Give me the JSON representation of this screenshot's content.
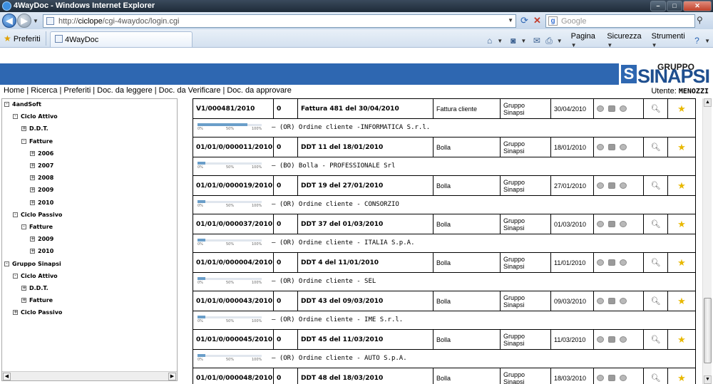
{
  "window": {
    "title": "4WayDoc - Windows Internet Explorer",
    "min": "–",
    "max": "□",
    "close": "✕"
  },
  "address": {
    "url_prefix": "http://",
    "url_host": "ciclope",
    "url_path": "/cgi-4waydoc/login.cgi",
    "search_placeholder": "Google"
  },
  "commandbar": {
    "favorites_label": "Preferiti",
    "tab_label": "4WayDoc",
    "menus": [
      "Pagina",
      "Sicurezza",
      "Strumenti"
    ]
  },
  "brand": {
    "gruppo": "GRUPPO",
    "name": "SINAPSI",
    "mark": "S"
  },
  "nav": {
    "items": [
      "Home",
      "Ricerca",
      "Preferiti",
      "Doc. da leggere",
      "Doc. da Verificare",
      "Doc. da approvare"
    ],
    "user_label": "Utente:",
    "user_name": "MENOZZI"
  },
  "tree": [
    {
      "label": "4andSoft",
      "sign": "-",
      "level": 0
    },
    {
      "label": "Ciclo Attivo",
      "sign": "-",
      "level": 1
    },
    {
      "label": "D.D.T.",
      "sign": "+",
      "level": 2
    },
    {
      "label": "Fatture",
      "sign": "-",
      "level": 2
    },
    {
      "label": "2006",
      "sign": "+",
      "level": 3
    },
    {
      "label": "2007",
      "sign": "+",
      "level": 3
    },
    {
      "label": "2008",
      "sign": "+",
      "level": 3
    },
    {
      "label": "2009",
      "sign": "+",
      "level": 3
    },
    {
      "label": "2010",
      "sign": "+",
      "level": 3
    },
    {
      "label": "Ciclo Passivo",
      "sign": "-",
      "level": 1
    },
    {
      "label": "Fatture",
      "sign": "-",
      "level": 2
    },
    {
      "label": "2009",
      "sign": "+",
      "level": 3
    },
    {
      "label": "2010",
      "sign": "+",
      "level": 3
    },
    {
      "label": "Gruppo Sinapsi",
      "sign": "-",
      "level": 0
    },
    {
      "label": "Ciclo Attivo",
      "sign": "-",
      "level": 1
    },
    {
      "label": "D.D.T.",
      "sign": "+",
      "level": 2
    },
    {
      "label": "Fatture",
      "sign": "+",
      "level": 2
    },
    {
      "label": "Ciclo Passivo",
      "sign": "+",
      "level": 1
    }
  ],
  "progress_ticks": [
    "0%",
    "50%",
    "100%"
  ],
  "documents": [
    {
      "number": "V1/000481/2010",
      "zero": "0",
      "desc": "Fattura 481 del 30/04/2010",
      "type": "Fattura cliente",
      "group": "Gruppo Sinapsi",
      "date": "30/04/2010",
      "progress": 0.78,
      "sub": "— (OR) Ordine cliente -INFORMATICA S.r.l."
    },
    {
      "number": "01/01/0/000011/2010",
      "zero": "0",
      "desc": "DDT 11 del 18/01/2010",
      "type": "Bolla",
      "group": "Gruppo Sinapsi",
      "date": "18/01/2010",
      "progress": 0.12,
      "sub": "— (BO) Bolla - PROFESSIONALE Srl"
    },
    {
      "number": "01/01/0/000019/2010",
      "zero": "0",
      "desc": "DDT 19 del 27/01/2010",
      "type": "Bolla",
      "group": "Gruppo Sinapsi",
      "date": "27/01/2010",
      "progress": 0.12,
      "sub": "— (OR) Ordine cliente - CONSORZIO"
    },
    {
      "number": "01/01/0/000037/2010",
      "zero": "0",
      "desc": "DDT 37 del 01/03/2010",
      "type": "Bolla",
      "group": "Gruppo Sinapsi",
      "date": "01/03/2010",
      "progress": 0.12,
      "sub": "— (OR) Ordine cliente - ITALIA S.p.A."
    },
    {
      "number": "01/01/0/000004/2010",
      "zero": "0",
      "desc": "DDT 4 del 11/01/2010",
      "type": "Bolla",
      "group": "Gruppo Sinapsi",
      "date": "11/01/2010",
      "progress": 0.12,
      "sub": "— (OR) Ordine cliente - SEL"
    },
    {
      "number": "01/01/0/000043/2010",
      "zero": "0",
      "desc": "DDT 43 del 09/03/2010",
      "type": "Bolla",
      "group": "Gruppo Sinapsi",
      "date": "09/03/2010",
      "progress": 0.12,
      "sub": "— (OR) Ordine cliente - IME S.r.l."
    },
    {
      "number": "01/01/0/000045/2010",
      "zero": "0",
      "desc": "DDT 45 del 11/03/2010",
      "type": "Bolla",
      "group": "Gruppo Sinapsi",
      "date": "11/03/2010",
      "progress": 0.12,
      "sub": "— (OR) Ordine cliente - AUTO S.p.A."
    },
    {
      "number": "01/01/0/000048/2010",
      "zero": "0",
      "desc": "DDT 48 del 18/03/2010",
      "type": "Bolla",
      "group": "Gruppo Sinapsi",
      "date": "18/03/2010",
      "progress": 0.12,
      "sub": ""
    }
  ]
}
